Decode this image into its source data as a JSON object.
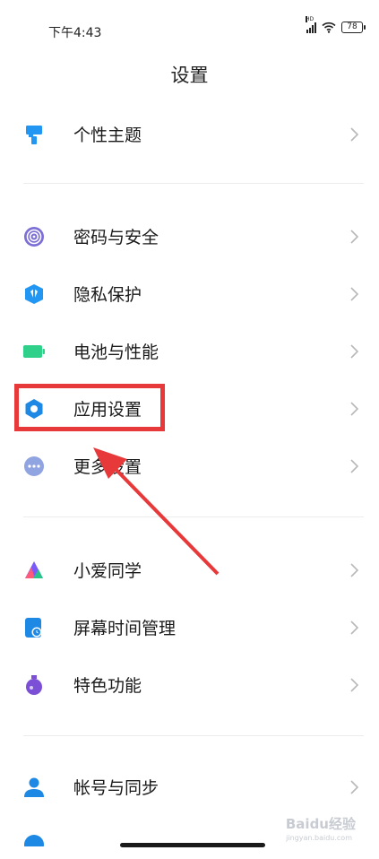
{
  "status_bar": {
    "time": "下午4:43",
    "network": "HD",
    "battery": "78"
  },
  "title": "设置",
  "groups": [
    {
      "items": [
        {
          "label": "个性主题",
          "icon": "brush-icon",
          "color": "#2196f3"
        }
      ]
    },
    {
      "items": [
        {
          "label": "密码与安全",
          "icon": "fingerprint-icon",
          "color": "#7b6fd6"
        },
        {
          "label": "隐私保护",
          "icon": "shield-icon",
          "color": "#2196f3"
        },
        {
          "label": "电池与性能",
          "icon": "battery-icon",
          "color": "#2fd08a"
        },
        {
          "label": "应用设置",
          "icon": "gear-icon",
          "color": "#1e88e5"
        },
        {
          "label": "更多设置",
          "icon": "more-icon",
          "color": "#8fa4e0"
        }
      ]
    },
    {
      "items": [
        {
          "label": "小爱同学",
          "icon": "xiaoai-icon",
          "color": "#7a5af8"
        },
        {
          "label": "屏幕时间管理",
          "icon": "screen-time-icon",
          "color": "#1e88e5"
        },
        {
          "label": "特色功能",
          "icon": "flask-icon",
          "color": "#7b4fd6"
        }
      ]
    },
    {
      "items": [
        {
          "label": "帐号与同步",
          "icon": "user-icon",
          "color": "#1e88e5"
        }
      ]
    }
  ],
  "annotation": {
    "highlight_color": "#e8393a"
  },
  "watermark": {
    "text": "Baidu经验",
    "sub": "jingyan.baidu.com"
  }
}
